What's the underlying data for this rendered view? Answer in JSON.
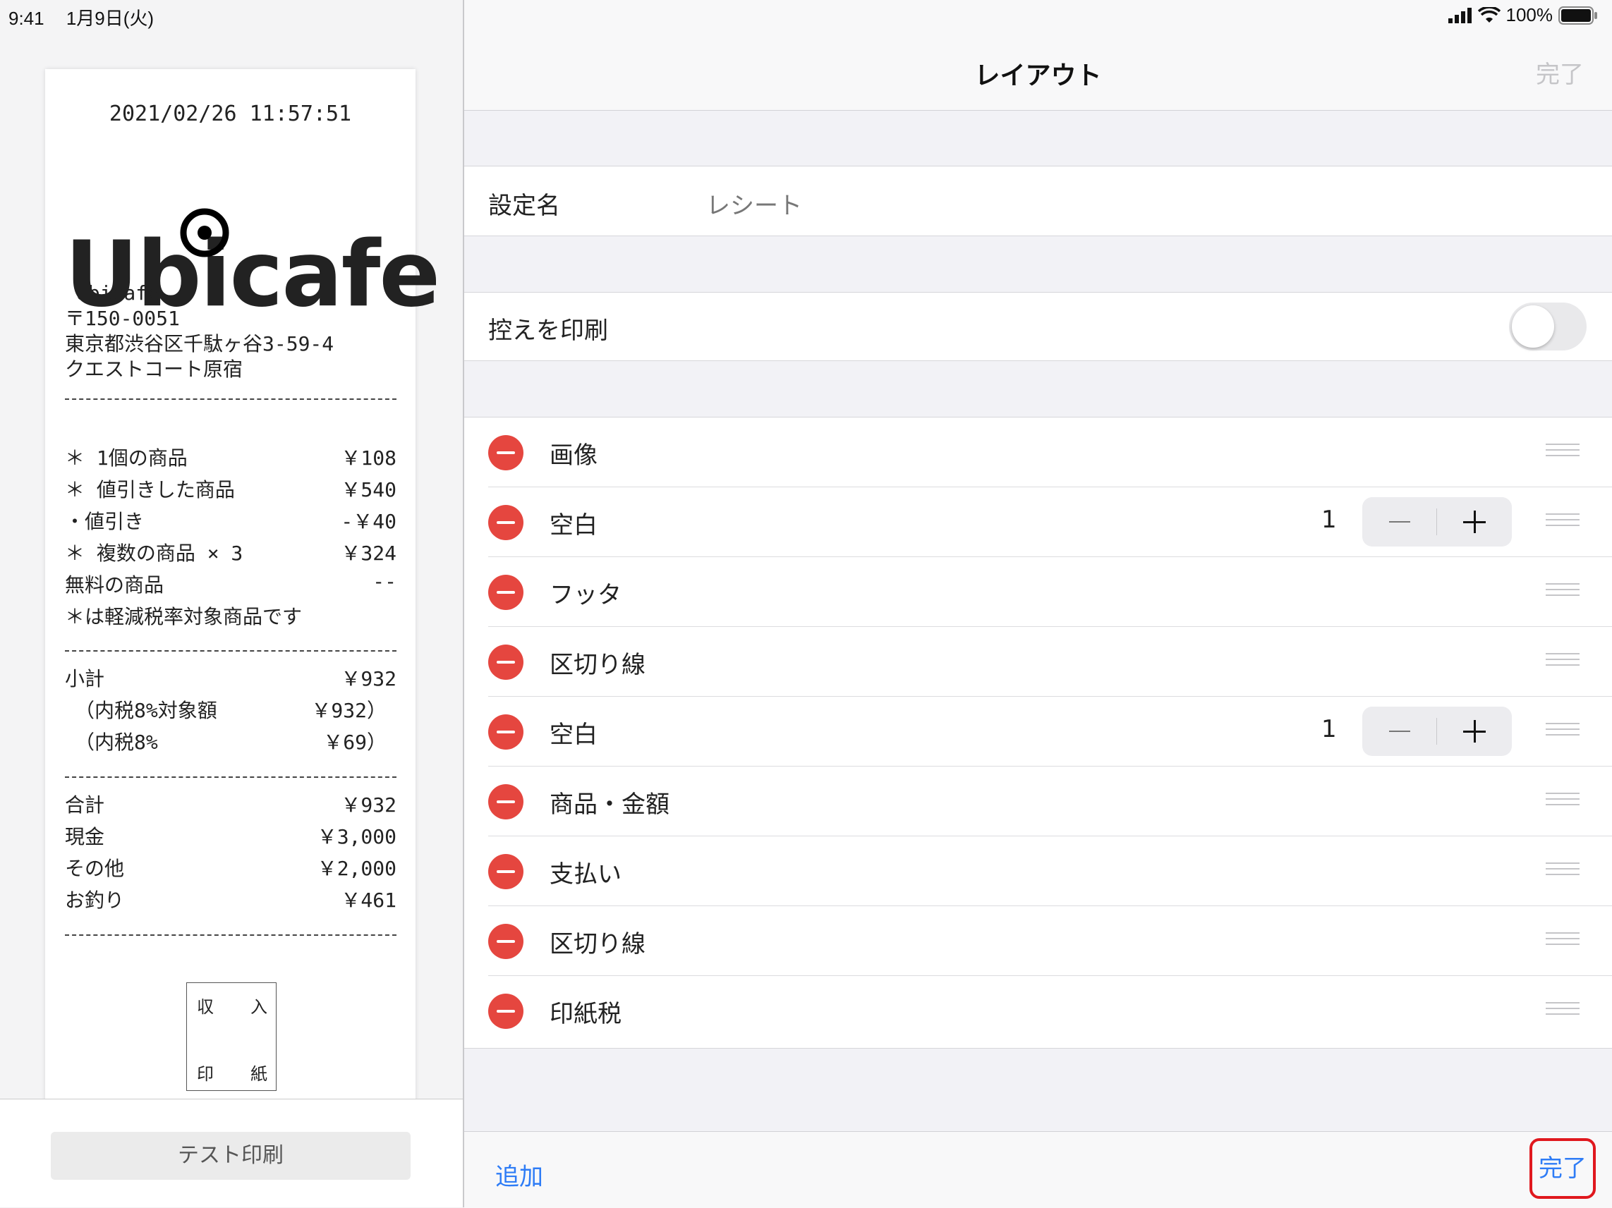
{
  "status": {
    "time": "9:41",
    "date": "1月9日(火)",
    "battery": "100%"
  },
  "receipt": {
    "datetime": "2021/02/26 11:57:51",
    "logo": "Ubicafe",
    "shop_lines": [
      "Ubicafe",
      "〒150-0051",
      "東京都渋谷区千駄ヶ谷3-59-4",
      "クエストコート原宿"
    ],
    "items": [
      {
        "label": "＊ 1個の商品",
        "value": "￥108"
      },
      {
        "label": "＊ 値引きした商品",
        "value": "￥540"
      },
      {
        "label": "・値引き",
        "value": "-￥40"
      },
      {
        "label": "＊ 複数の商品 × 3",
        "value": "￥324"
      },
      {
        "label": "無料の商品",
        "value": "--"
      }
    ],
    "note": "＊は軽減税率対象商品です",
    "subtotal": [
      {
        "label": "小計",
        "value": "￥932"
      },
      {
        "label": "（内税8%対象額",
        "value": "￥932）"
      },
      {
        "label": "（内税8%",
        "value": "￥69）"
      }
    ],
    "totals": [
      {
        "label": "合計",
        "value": "￥932"
      },
      {
        "label": "現金",
        "value": "￥3,000"
      },
      {
        "label": "その他",
        "value": "￥2,000"
      },
      {
        "label": "お釣り",
        "value": "￥461"
      }
    ],
    "stamp": [
      "収",
      "入",
      "印",
      "紙"
    ]
  },
  "test_print_label": "テスト印刷",
  "nav": {
    "title": "レイアウト",
    "done": "完了"
  },
  "setting": {
    "label": "設定名",
    "value": "レシート"
  },
  "copy_print": {
    "label": "控えを印刷",
    "enabled": false
  },
  "layout_items": [
    {
      "name": "画像"
    },
    {
      "name": "空白",
      "count": "1"
    },
    {
      "name": "フッタ"
    },
    {
      "name": "区切り線"
    },
    {
      "name": "空白",
      "count": "1"
    },
    {
      "name": "商品・金額"
    },
    {
      "name": "支払い"
    },
    {
      "name": "区切り線"
    },
    {
      "name": "印紙税"
    }
  ],
  "toolbar": {
    "add": "追加",
    "done": "完了"
  },
  "colors": {
    "accent": "#2e7cf6",
    "delete": "#e5463f",
    "highlight": "#e0181e"
  }
}
